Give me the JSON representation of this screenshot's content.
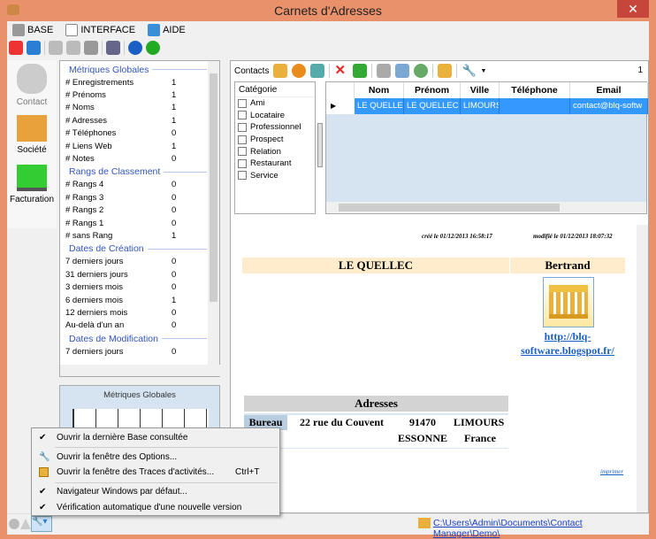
{
  "window": {
    "title": "Carnets d'Adresses",
    "close": "✕"
  },
  "menu": [
    {
      "label": "BASE",
      "icon": "database-icon"
    },
    {
      "label": "INTERFACE",
      "icon": "window-icon"
    },
    {
      "label": "AIDE",
      "icon": "help-icon"
    }
  ],
  "nav": [
    {
      "label": "Contact"
    },
    {
      "label": "Société"
    },
    {
      "label": "Facturation"
    }
  ],
  "stats": {
    "sections": [
      {
        "title": "Métriques Globales",
        "rows": [
          [
            "# Enregistrements",
            "1"
          ],
          [
            "# Prénoms",
            "1"
          ],
          [
            "# Noms",
            "1"
          ],
          [
            "# Adresses",
            "1"
          ],
          [
            "# Téléphones",
            "0"
          ],
          [
            "# Liens Web",
            "1"
          ],
          [
            "# Notes",
            "0"
          ]
        ]
      },
      {
        "title": "Rangs de Classement",
        "rows": [
          [
            "# Rangs 4",
            "0"
          ],
          [
            "# Rangs 3",
            "0"
          ],
          [
            "# Rangs 2",
            "0"
          ],
          [
            "# Rangs 1",
            "0"
          ],
          [
            "# sans Rang",
            "1"
          ]
        ]
      },
      {
        "title": "Dates de Création",
        "rows": [
          [
            "7 derniers jours",
            "0"
          ],
          [
            "31 derniers jours",
            "0"
          ],
          [
            "3 derniers mois",
            "0"
          ],
          [
            "6 derniers mois",
            "1"
          ],
          [
            "12 derniers mois",
            "0"
          ],
          [
            "Au-delà d'un an",
            "0"
          ]
        ]
      },
      {
        "title": "Dates de Modification",
        "rows": [
          [
            "7 derniers jours",
            "0"
          ]
        ]
      }
    ],
    "chart_title": "Métriques Globales"
  },
  "contacts": {
    "label": "Contacts",
    "count": "1",
    "category_header": "Catégorie",
    "categories": [
      "Ami",
      "Locataire",
      "Professionnel",
      "Prospect",
      "Relation",
      "Restaurant",
      "Service"
    ],
    "columns": [
      "Nom",
      "Prénom",
      "Ville",
      "Téléphone",
      "Email"
    ],
    "rows": [
      [
        "LE QUELLEC",
        "LE QUELLEC",
        "LIMOURS",
        "",
        "contact@blq-softw"
      ]
    ]
  },
  "detail": {
    "created": "créé le 01/12/2013 16:58:17",
    "modified": "modifié le 01/12/2013 18:07:32",
    "name": "LE QUELLEC",
    "firstname": "Bertrand",
    "link1": "http://blq-",
    "link2": "software.blogspot.fr/",
    "addresses_title": "Adresses",
    "addr_type": "Bureau",
    "street": "22 rue du Couvent",
    "zip": "91470",
    "city": "LIMOURS",
    "dept": "ESSONNE",
    "country": "France",
    "print": "imprimer"
  },
  "context_menu": [
    {
      "label": "Ouvrir la dernière Base consultée",
      "checked": true
    },
    {
      "label": "Ouvrir la fenêtre des Options...",
      "icon": "wrench-icon"
    },
    {
      "label": "Ouvrir la fenêtre des Traces d'activités...",
      "shortcut": "Ctrl+T",
      "icon": "log-icon"
    },
    {
      "label": "Navigateur Windows par défaut...",
      "checked": true
    },
    {
      "label": "Vérification automatique d'une nouvelle version",
      "checked": true
    }
  ],
  "check": "✔",
  "status": {
    "path": "C:\\Users\\Admin\\Documents\\Contact Manager\\Demo\\"
  }
}
